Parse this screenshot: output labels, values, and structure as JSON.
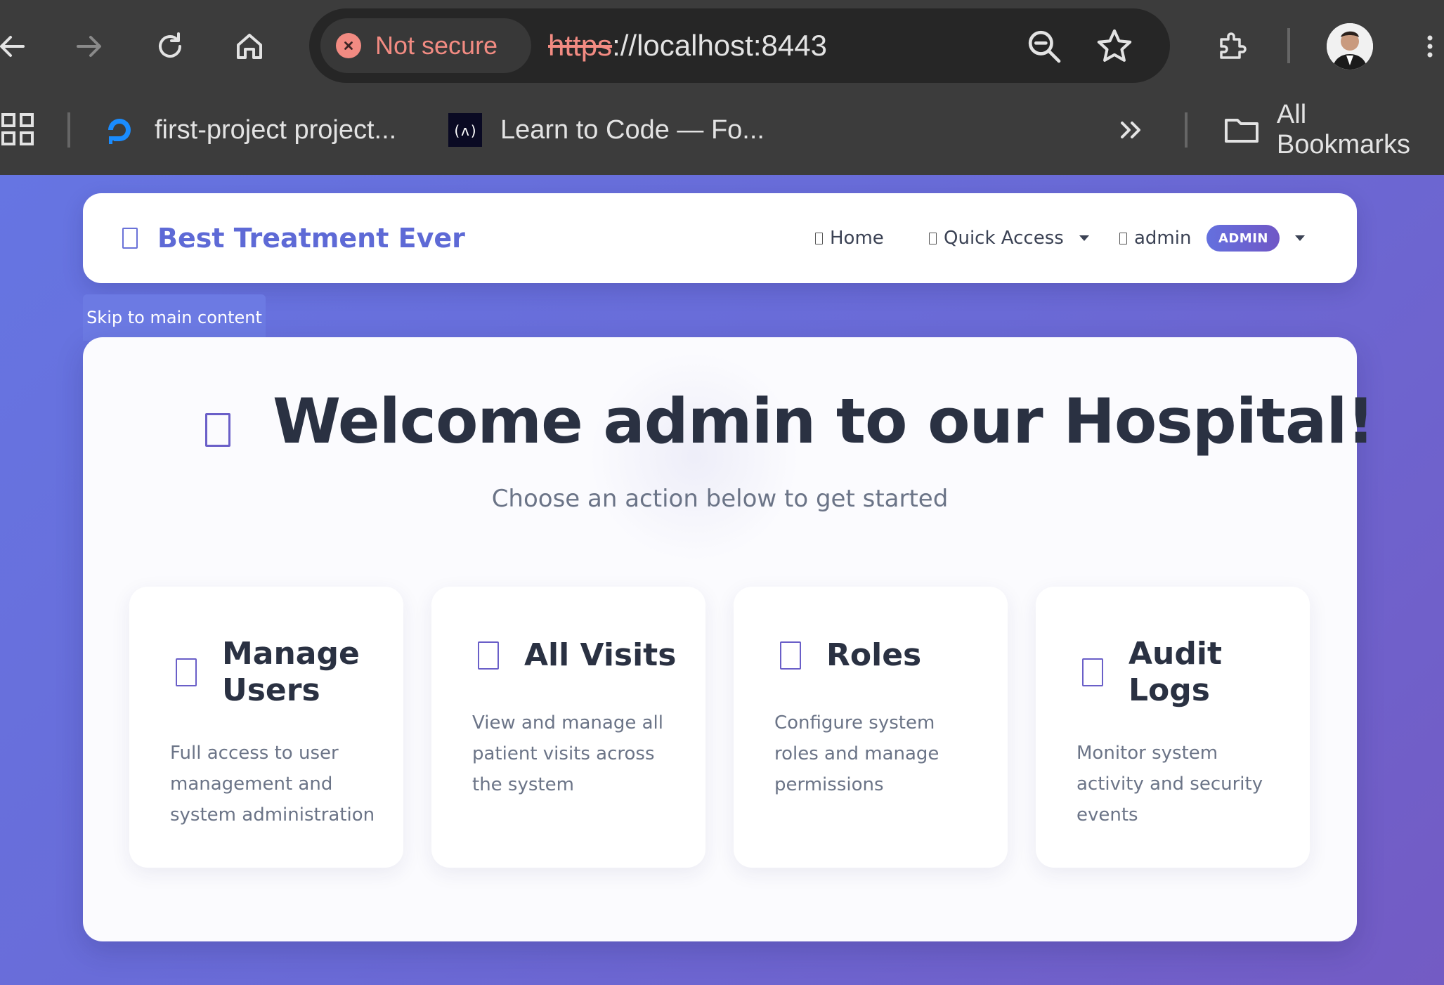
{
  "browser": {
    "security_chip": "Not secure",
    "url_scheme": "https",
    "url_rest": "://localhost:8443",
    "bookmarks": [
      {
        "label": "first-project project...",
        "icon": "digitalocean-icon"
      },
      {
        "label": "Learn to Code — Fo...",
        "icon": "freecodecamp-icon"
      }
    ],
    "all_bookmarks": "All Bookmarks"
  },
  "navbar": {
    "brand": "Best Treatment Ever",
    "home": "Home",
    "quick_access": "Quick Access",
    "user": "admin",
    "role_badge": "ADMIN"
  },
  "skip_link": "Skip to main content",
  "hero": {
    "title": "Welcome admin to our Hospital!",
    "subtitle": "Choose an action below to get started"
  },
  "cards": [
    {
      "title": "Manage Users",
      "description": "Full access to user management and system administration"
    },
    {
      "title": "All Visits",
      "description": "View and manage all patient visits across the system"
    },
    {
      "title": "Roles",
      "description": "Configure system roles and manage permissions"
    },
    {
      "title": "Audit Logs",
      "description": "Monitor system activity and security events"
    }
  ]
}
